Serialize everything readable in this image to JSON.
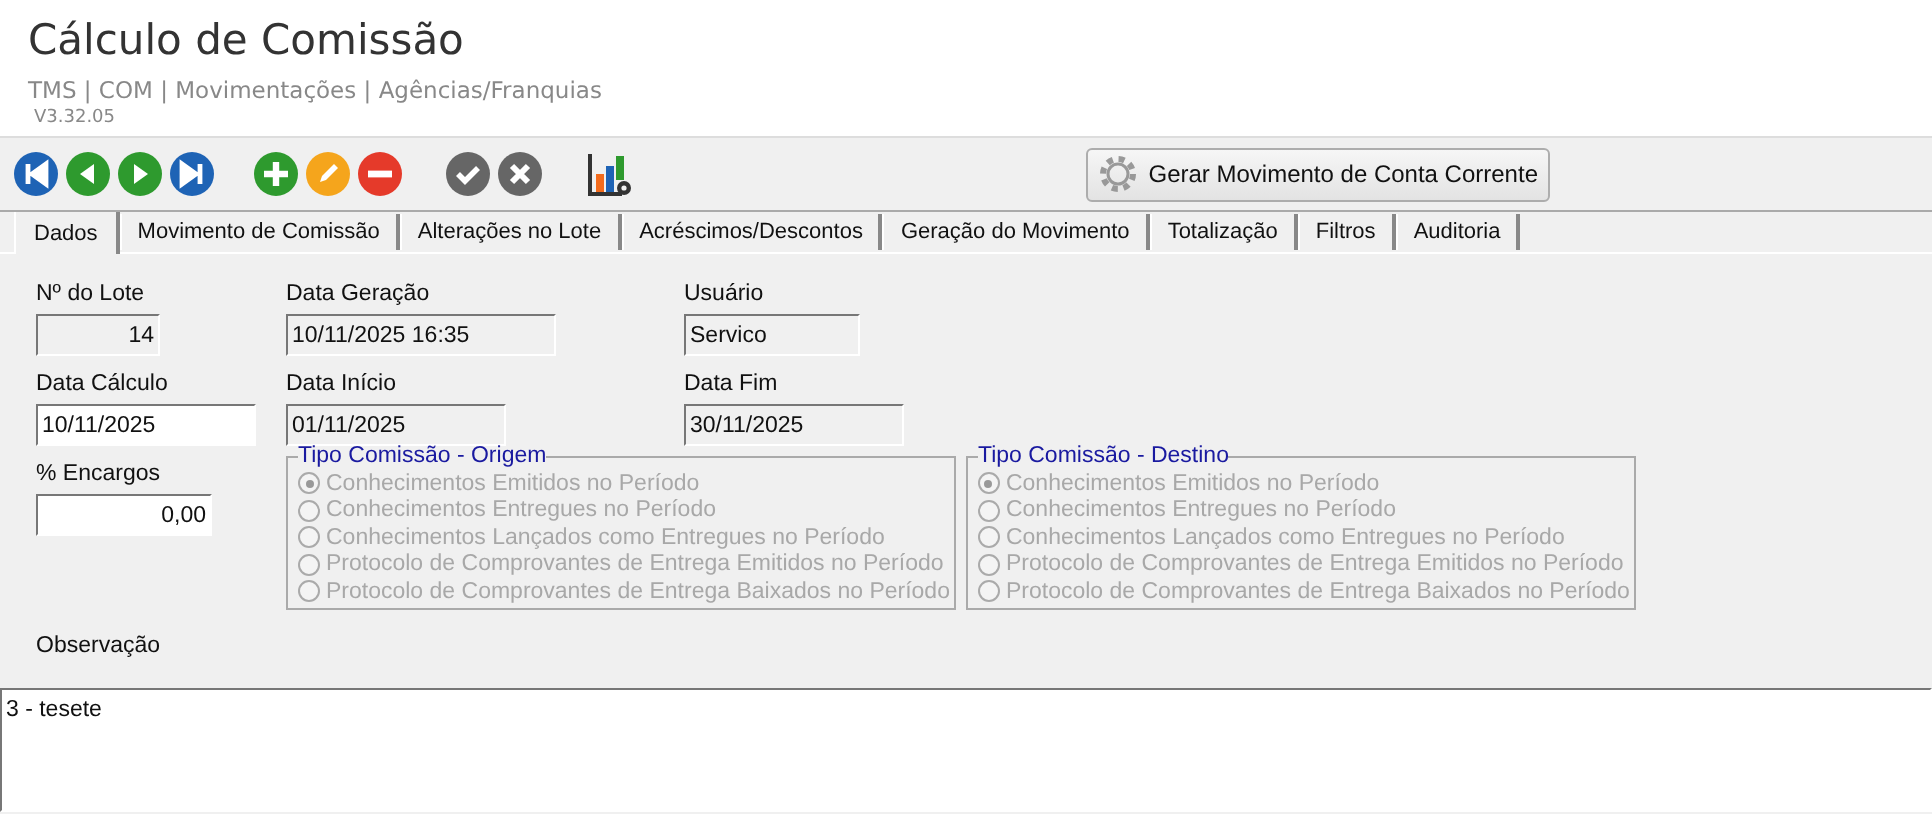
{
  "header": {
    "title": "Cálculo de Comissão",
    "breadcrumb": "TMS | COM | Movimentações | Agências/Franquias",
    "version": "V3.32.05"
  },
  "toolbar": {
    "action_button": "Gerar Movimento de Conta Corrente"
  },
  "tabs": [
    {
      "label": "Dados",
      "selected": true
    },
    {
      "label": "Movimento de Comissão",
      "selected": false
    },
    {
      "label": "Alterações no Lote",
      "selected": false
    },
    {
      "label": "Acréscimos/Descontos",
      "selected": false
    },
    {
      "label": "Geração do Movimento",
      "selected": false
    },
    {
      "label": "Totalização",
      "selected": false
    },
    {
      "label": "Filtros",
      "selected": false
    },
    {
      "label": "Auditoria",
      "selected": false
    }
  ],
  "fields": [
    {
      "label": "Nº do Lote",
      "value": "14",
      "editable": false,
      "numeric": true
    },
    {
      "label": "Data Geração",
      "value": "10/11/2025 16:35",
      "editable": false,
      "numeric": false
    },
    {
      "label": "Usuário",
      "value": "Servico",
      "editable": false,
      "numeric": false
    },
    {
      "label": "Data Cálculo",
      "value": "10/11/2025",
      "editable": true,
      "numeric": false
    },
    {
      "label": "Data Início",
      "value": "01/11/2025",
      "editable": false,
      "numeric": false
    },
    {
      "label": "Data Fim",
      "value": "30/11/2025",
      "editable": false,
      "numeric": false
    },
    {
      "label": "% Encargos",
      "value": "0,00",
      "editable": true,
      "numeric": true
    }
  ],
  "radio_groups": [
    {
      "title": "Tipo Comissão - Origem",
      "disabled": true,
      "options": [
        {
          "label": "Conhecimentos Emitidos no Período",
          "selected": true
        },
        {
          "label": "Conhecimentos Entregues no Período",
          "selected": false
        },
        {
          "label": "Conhecimentos Lançados como Entregues no Período",
          "selected": false
        },
        {
          "label": "Protocolo de Comprovantes de Entrega Emitidos no Período",
          "selected": false
        },
        {
          "label": "Protocolo de Comprovantes de Entrega Baixados no Período",
          "selected": false
        }
      ]
    },
    {
      "title": "Tipo Comissão - Destino",
      "disabled": true,
      "options": [
        {
          "label": "Conhecimentos Emitidos no Período",
          "selected": true
        },
        {
          "label": "Conhecimentos Entregues no Período",
          "selected": false
        },
        {
          "label": "Conhecimentos Lançados como Entregues no Período",
          "selected": false
        },
        {
          "label": "Protocolo de Comprovantes de Entrega Emitidos no Período",
          "selected": false
        },
        {
          "label": "Protocolo de Comprovantes de Entrega Baixados no Período",
          "selected": false
        }
      ]
    }
  ],
  "observation": {
    "label": "Observação",
    "value": "3 - tesete"
  }
}
